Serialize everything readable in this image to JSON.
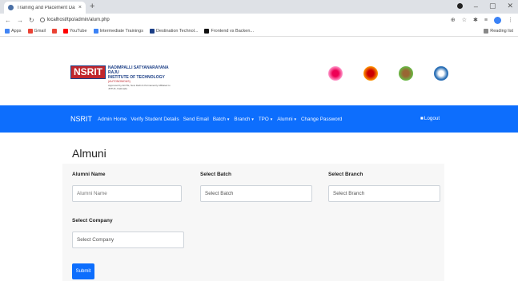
{
  "browser": {
    "tab_title": "Training and Placement Dashbo",
    "tab_close": "×",
    "new_tab": "+",
    "url": "localhost/tpo/admin/alum.php",
    "bookmarks": [
      "Apps",
      "Gmail",
      "YouTube",
      "Intermediate Trainings",
      "Destination Technol...",
      "Frontend vs Backen..."
    ],
    "reading_list": "Reading list"
  },
  "header": {
    "logo_text": "NSRIT",
    "college_line1": "NADIMPALLI SATYANARAYANA RAJU",
    "college_line2": "INSTITUTE OF TECHNOLOGY",
    "college_line3": "(AUTONOMOUS)",
    "college_line4": "Approved by AICTE, New Delhi & Permanently Affiliated to JNTUK, Kakinada"
  },
  "nav": {
    "brand": "NSRIT",
    "items": [
      {
        "label": "Admin Home",
        "caret": false
      },
      {
        "label": "Verify Student Details",
        "caret": false
      },
      {
        "label": "Send Email",
        "caret": false
      },
      {
        "label": "Batch",
        "caret": true
      },
      {
        "label": "Branch",
        "caret": true
      },
      {
        "label": "TPO",
        "caret": true
      },
      {
        "label": "Alumni",
        "caret": true
      },
      {
        "label": "Change Password",
        "caret": false
      }
    ],
    "logout": "Logout"
  },
  "main": {
    "title": "Almuni",
    "fields": {
      "alumni_name_label": "Alumni Name",
      "alumni_name_placeholder": "Alumni Name",
      "batch_label": "Select Batch",
      "batch_value": "Select Batch",
      "branch_label": "Select Branch",
      "branch_value": "Select Branch",
      "company_label": "Select Company",
      "company_value": "Select Company"
    },
    "submit_label": "Submit"
  },
  "colors": {
    "nav_bg": "#0d6efd",
    "logo_red": "#c1272d",
    "logo_blue": "#1b3e86"
  }
}
